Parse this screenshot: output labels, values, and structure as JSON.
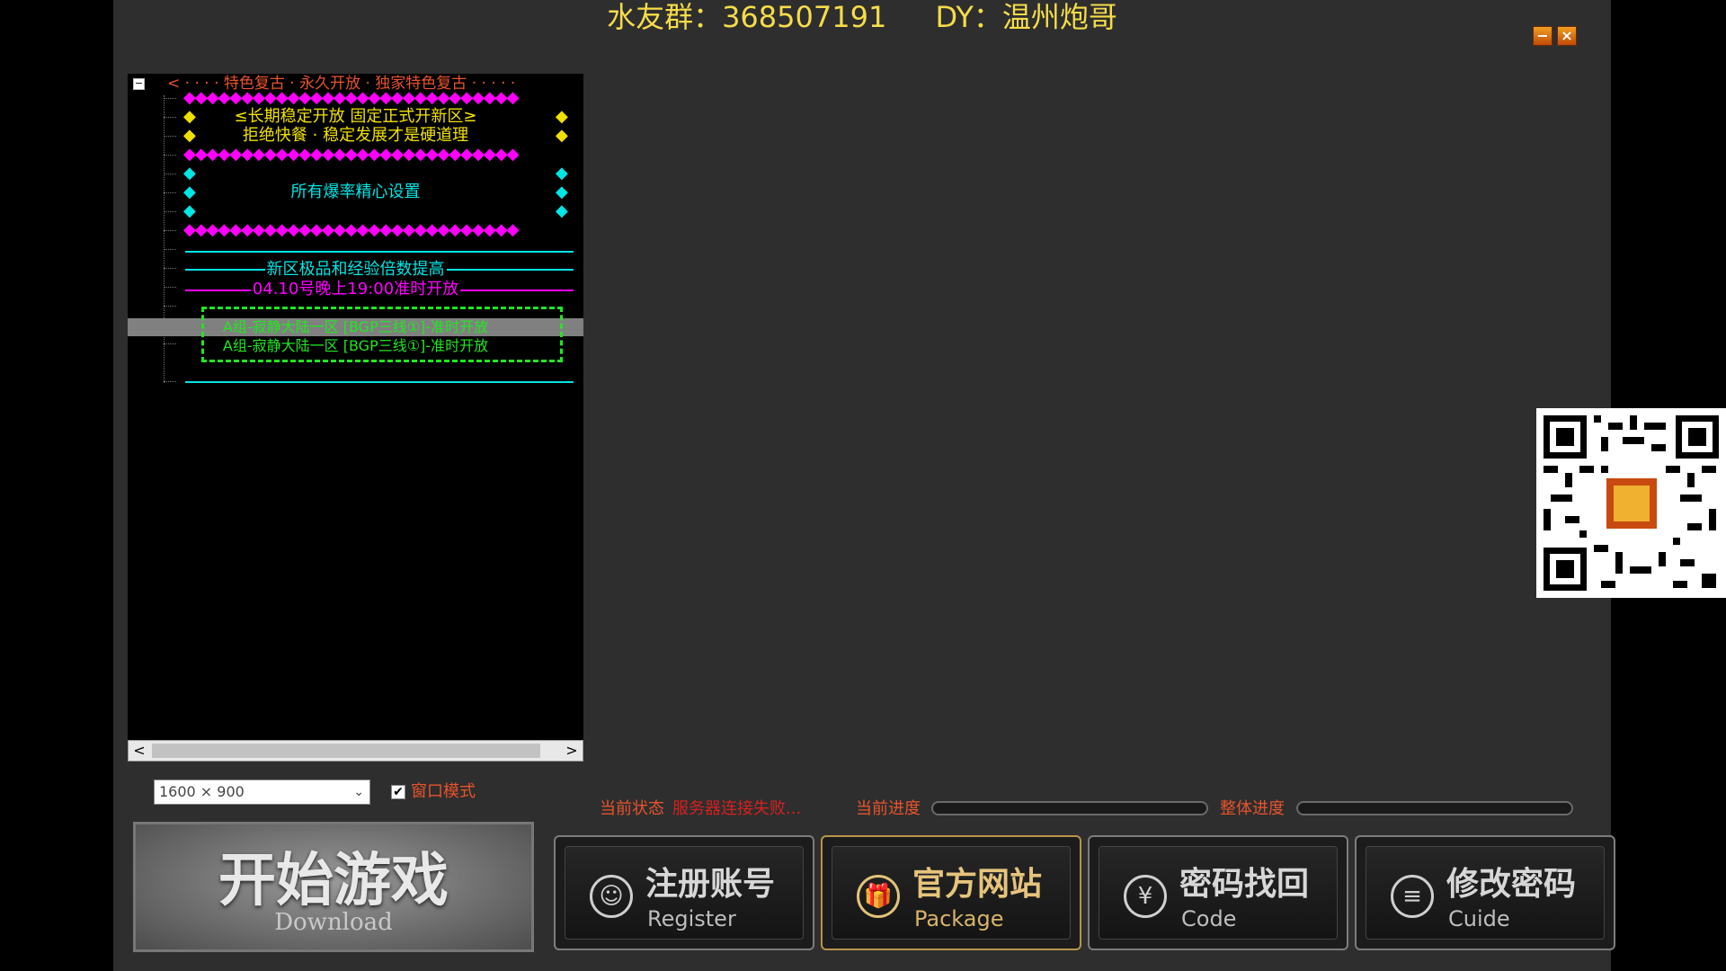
{
  "title": {
    "group": "水友群：368507191",
    "douyin": "DY：温州炮哥"
  },
  "window_buttons": {
    "minimize": "−",
    "close": "×"
  },
  "notice": {
    "collapse": "−",
    "header": "< · · · · 特色复古 · 永久开放 · 独家特色复古 · · · · ·",
    "dia_magenta": "◆◆◆◆◆◆◆◆◆◆◆◆◆◆◆◆◆◆◆◆◆◆◆◆◆◆◆◆◆",
    "dia_yellow": "◆",
    "dia_cyan": "◆",
    "line1": "≤长期稳定开放 固定正式开新区≥",
    "line2": "拒绝快餐 · 稳定发展才是硬道理",
    "line3": "所有爆率精心设置",
    "line4": "新区极品和经验倍数提高",
    "line5": "04.10号晚上19:00准时开放",
    "server1": "A组-寂静大陆一区 [BGP三线①]-准时开放",
    "server2": "A组-寂静大陆一区 [BGP三线①]-准时开放"
  },
  "scrollbar": {
    "left": "<",
    "right": ">"
  },
  "resolution": {
    "value": "1600 × 900",
    "chevron": "⌄"
  },
  "window_mode": {
    "checked": "✔",
    "label": "窗口模式"
  },
  "status": {
    "current_state_label": "当前状态",
    "current_state_value": "服务器连接失败...",
    "current_progress_label": "当前进度",
    "current_progress": 0,
    "overall_progress_label": "整体进度",
    "overall_progress": 0
  },
  "start_button": {
    "title": "开始游戏",
    "subtitle": "Download"
  },
  "actions": [
    {
      "title": "注册账号",
      "subtitle": "Register",
      "icon": "user-icon",
      "glyph": "☺"
    },
    {
      "title": "官方网站",
      "subtitle": "Package",
      "icon": "gift-icon",
      "glyph": "🎁"
    },
    {
      "title": "密码找回",
      "subtitle": "Code",
      "icon": "yen-icon",
      "glyph": "¥"
    },
    {
      "title": "修改密码",
      "subtitle": "Cuide",
      "icon": "list-icon",
      "glyph": "≡"
    }
  ],
  "colors": {
    "accent_title": "#f5dc4a",
    "status_label": "#e8532c",
    "status_error": "#d42020",
    "notice_magenta": "#ff00ff",
    "notice_cyan": "#00e5e5",
    "notice_yellow": "#f0e000",
    "notice_green": "#22e622",
    "gold_button": "#e6c47c"
  }
}
